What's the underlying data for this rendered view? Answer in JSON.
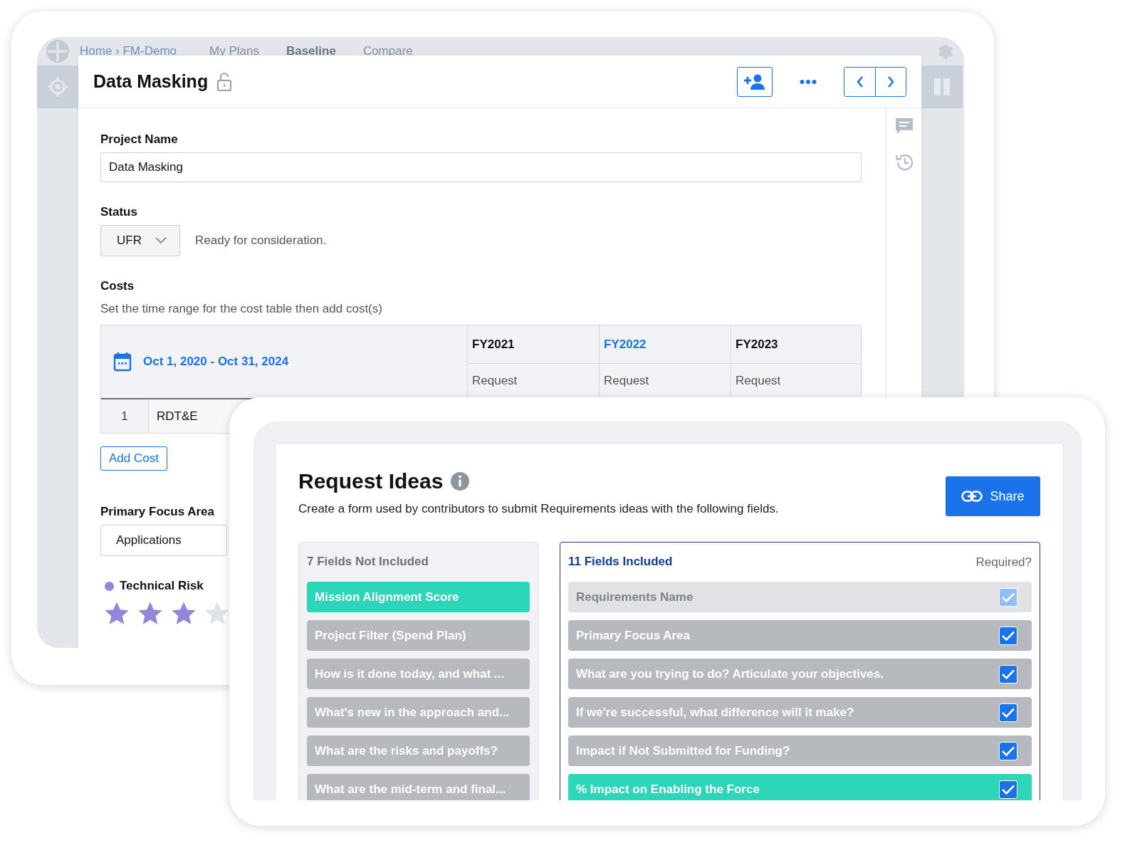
{
  "back_window": {
    "nav": {
      "breadcrumb": "Home › FM-Demo",
      "tabs": [
        {
          "label": "My Plans",
          "selected": false
        },
        {
          "label": "Baseline",
          "selected": true
        },
        {
          "label": "Compare",
          "selected": false
        }
      ]
    },
    "header": {
      "title": "Data Masking"
    },
    "project_name": {
      "label": "Project Name",
      "value": "Data Masking"
    },
    "status": {
      "label": "Status",
      "value": "UFR",
      "description": "Ready for consideration."
    },
    "costs": {
      "label": "Costs",
      "hint": "Set the time range for the cost table then add cost(s)",
      "date_range": "Oct 1, 2020 - Oct 31, 2024",
      "columns": [
        {
          "label": "FY2021",
          "sub_label": "Request",
          "selected": false
        },
        {
          "label": "FY2022",
          "sub_label": "Request",
          "selected": true
        },
        {
          "label": "FY2023",
          "sub_label": "Request",
          "selected": false
        }
      ],
      "rows": [
        {
          "number": "1",
          "name": "RDT&E"
        }
      ],
      "add_button": "Add Cost"
    },
    "primary_focus_area": {
      "label": "Primary Focus Area",
      "value": "Applications"
    },
    "technical_risk": {
      "label": "Technical Risk",
      "color": "#9585db",
      "stars": 3
    }
  },
  "request_ideas": {
    "title": "Request Ideas",
    "description": "Create a form used by contributors to submit Requirements ideas with the following fields.",
    "share_button": "Share",
    "not_included": {
      "title": "7 Fields Not Included",
      "fields": [
        {
          "label": "Mission Alignment Score",
          "selected": true
        },
        {
          "label": "Project Filter (Spend Plan)",
          "selected": false
        },
        {
          "label": "How is it done today, and what ...",
          "selected": false
        },
        {
          "label": "What's new in the approach and...",
          "selected": false
        },
        {
          "label": "What are the risks and payoffs?",
          "selected": false
        },
        {
          "label": "What are the mid-term and final...",
          "selected": false
        }
      ]
    },
    "included": {
      "title": "11 Fields Included",
      "required_label": "Required?",
      "fields": [
        {
          "label": "Requirements Name",
          "selected": false,
          "disabled": true,
          "checked": true
        },
        {
          "label": "Primary Focus Area",
          "selected": false,
          "disabled": false,
          "checked": true
        },
        {
          "label": "What are you trying to do? Articulate your objectives.",
          "selected": false,
          "disabled": false,
          "checked": true
        },
        {
          "label": "If we're successful, what difference will it make?",
          "selected": false,
          "disabled": false,
          "checked": true
        },
        {
          "label": "Impact if Not Submitted for Funding?",
          "selected": false,
          "disabled": false,
          "checked": true
        },
        {
          "label": "% Impact on Enabling the Force",
          "selected": true,
          "disabled": false,
          "checked": true
        }
      ]
    }
  }
}
